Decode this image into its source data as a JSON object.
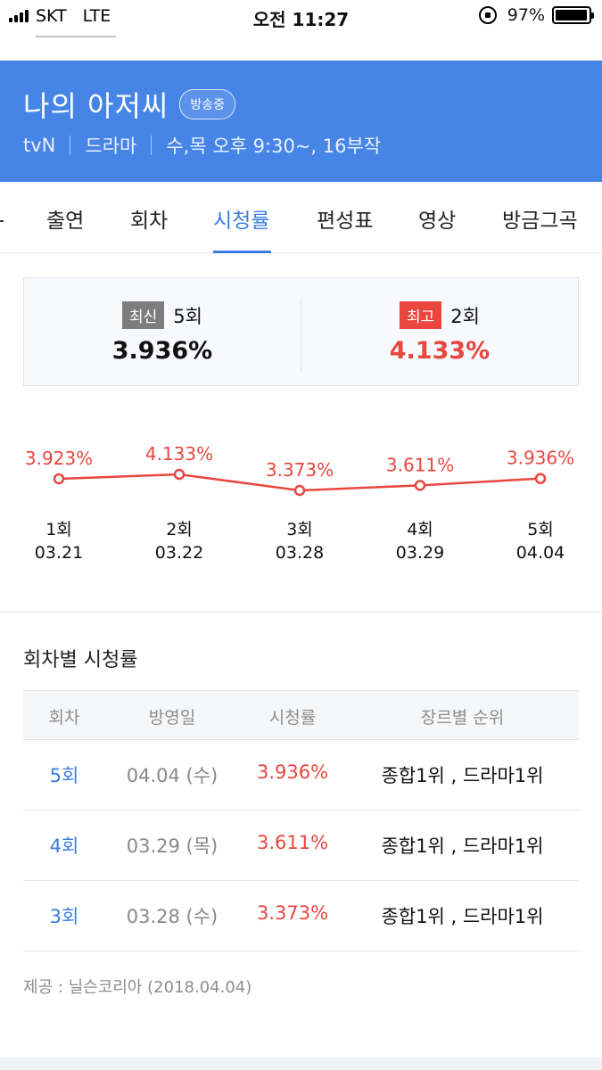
{
  "status_bar": {
    "carrier": "SKT",
    "network": "LTE",
    "time": "오전 11:27",
    "battery_percent": "97%",
    "battery_level": 0.97
  },
  "header": {
    "title": "나의 아저씨",
    "badge": "방송중",
    "channel": "tvN",
    "genre": "드라마",
    "schedule": "수,목 오후 9:30~, 16부작",
    "background_color": "#4685e6"
  },
  "tabs": [
    {
      "label": "출연",
      "active": false
    },
    {
      "label": "회차",
      "active": false
    },
    {
      "label": "시청률",
      "active": true
    },
    {
      "label": "편성표",
      "active": false
    },
    {
      "label": "영상",
      "active": false
    },
    {
      "label": "방금그곡",
      "active": false
    }
  ],
  "summary": {
    "latest": {
      "tag": "최신",
      "episode": "5회",
      "value": "3.936%"
    },
    "best": {
      "tag": "최고",
      "episode": "2회",
      "value": "4.133%"
    }
  },
  "chart_data": {
    "type": "line",
    "color": "#e8463f",
    "points": [
      {
        "episode": "1회",
        "date": "03.21",
        "value": 3.923,
        "label": "3.923%"
      },
      {
        "episode": "2회",
        "date": "03.22",
        "value": 4.133,
        "label": "4.133%"
      },
      {
        "episode": "3회",
        "date": "03.28",
        "value": 3.373,
        "label": "3.373%"
      },
      {
        "episode": "4회",
        "date": "03.29",
        "value": 3.611,
        "label": "3.611%"
      },
      {
        "episode": "5회",
        "date": "04.04",
        "value": 3.936,
        "label": "3.936%"
      }
    ]
  },
  "ratings_table": {
    "title": "회차별 시청률",
    "columns": [
      "회차",
      "방영일",
      "시청률",
      "장르별 순위"
    ],
    "rows": [
      {
        "episode": "5회",
        "date": "04.04 (수)",
        "rating": "3.936%",
        "rank": "종합1위 , 드라마1위"
      },
      {
        "episode": "4회",
        "date": "03.29 (목)",
        "rating": "3.611%",
        "rank": "종합1위 , 드라마1위"
      },
      {
        "episode": "3회",
        "date": "03.28 (수)",
        "rating": "3.373%",
        "rank": "종합1위 , 드라마1위"
      }
    ],
    "source": "제공 : 닐슨코리아 (2018.04.04)"
  }
}
